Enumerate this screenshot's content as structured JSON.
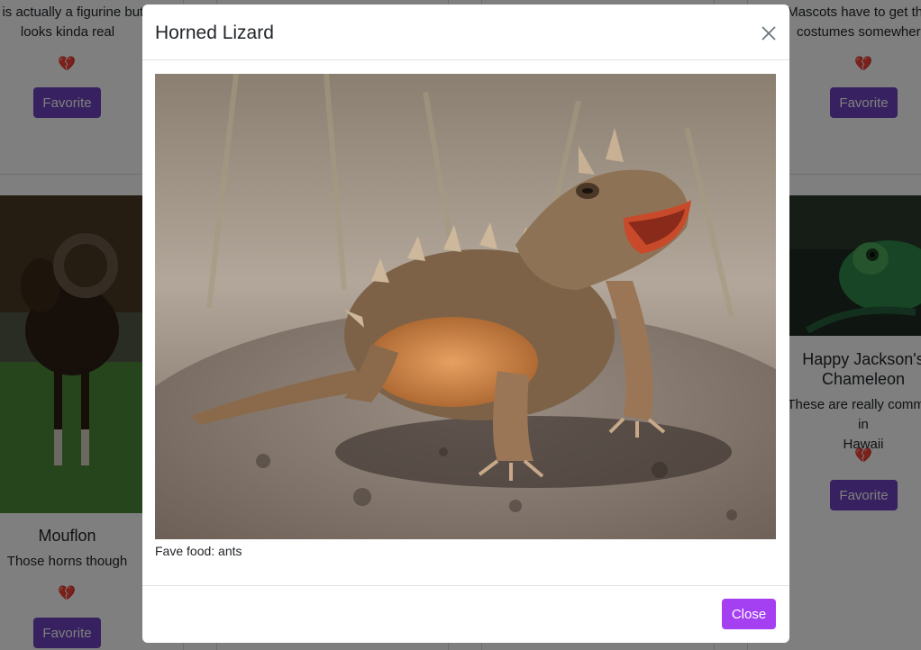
{
  "background_cards": {
    "left_top": {
      "text": "s is actually a figurine but it looks kinda real",
      "text_line1": "s is actually a figurine but",
      "text_line2": "looks kinda real",
      "favorite_label": "Favorite"
    },
    "right_top": {
      "text_line1": "Mascots have to get their",
      "text_line2": "costumes somewhere",
      "favorite_label": "Favorite"
    },
    "left_bottom": {
      "title": "Mouflon",
      "text": "Those horns though",
      "favorite_label": "Favorite"
    },
    "right_bottom": {
      "title_line1": "Happy Jackson's",
      "title_line2": "Chameleon",
      "text_line1": "These are really common in",
      "text_line2": "Hawaii",
      "favorite_label": "Favorite"
    },
    "heart_glyph": "💔"
  },
  "modal": {
    "title": "Horned Lizard",
    "image_alt": "Horned Lizard",
    "fave_food": "Fave food: ants",
    "close_button": "Close",
    "close_icon": "close-icon"
  },
  "colors": {
    "favorite_button": "#6f42c1",
    "close_button": "#a43ff2",
    "backdrop": "rgba(0,0,0,0.5)"
  }
}
